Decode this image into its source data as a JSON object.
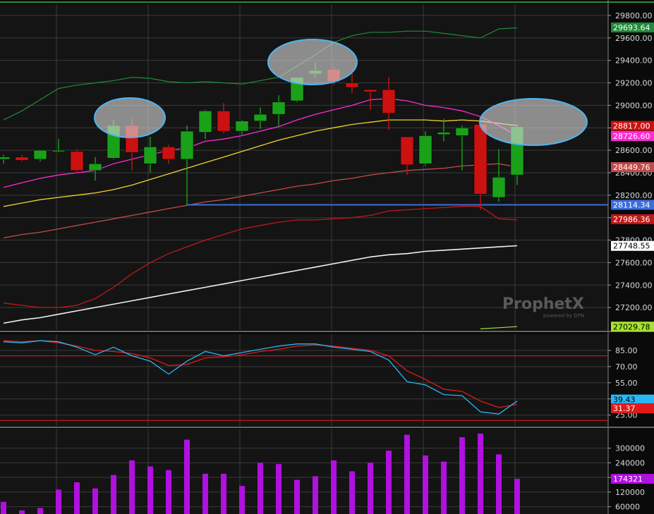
{
  "colors": {
    "background": "#141414",
    "grid": "#3a3a3a",
    "up": "#1aa11a",
    "down": "#cc1111",
    "bb": "#1f8a3a",
    "ema_magenta": "#ff2bd6",
    "ema_yellow": "#f2d22a",
    "sma_red": "#c24a4a",
    "dark_red": "#c01818",
    "white_ma": "#f0f0f0",
    "support": "#3a6ddc",
    "highlight": "#4fb4f0",
    "stoch_k": "#29b6f6",
    "stoch_d": "#e01a1a",
    "volume": "#b010e0",
    "top_border": "#2e8b3a"
  },
  "watermark": {
    "brand": "ProphetX",
    "sub": "powered by DTN"
  },
  "chart_data": [
    {
      "type": "candlestick",
      "panel": "price",
      "ylim": [
        27000,
        29900
      ],
      "yticks": [
        27200,
        27400,
        27600,
        27800,
        28000,
        28200,
        28400,
        28600,
        28800,
        29000,
        29200,
        29400,
        29600,
        29800
      ],
      "ytick_labels": [
        "27200.00",
        "27400.00",
        "27600.00",
        "27800.00",
        "28000.00",
        "28200.00",
        "28400.00",
        "28600.00",
        "28800.00",
        "29000.00",
        "29200.00",
        "29400.00",
        "29600.00",
        "29800.00"
      ],
      "candles": [
        {
          "o": 28520,
          "h": 28560,
          "l": 28480,
          "c": 28540
        },
        {
          "o": 28540,
          "h": 28560,
          "l": 28500,
          "c": 28510
        },
        {
          "o": 28520,
          "h": 28600,
          "l": 28500,
          "c": 28600
        },
        {
          "o": 28600,
          "h": 28700,
          "l": 28580,
          "c": 28600
        },
        {
          "o": 28590,
          "h": 28610,
          "l": 28400,
          "c": 28420
        },
        {
          "o": 28420,
          "h": 28540,
          "l": 28330,
          "c": 28480
        },
        {
          "o": 28530,
          "h": 28870,
          "l": 28520,
          "c": 28820
        },
        {
          "o": 28820,
          "h": 28880,
          "l": 28420,
          "c": 28580
        },
        {
          "o": 28480,
          "h": 28720,
          "l": 28400,
          "c": 28630
        },
        {
          "o": 28630,
          "h": 28650,
          "l": 28480,
          "c": 28520
        },
        {
          "o": 28520,
          "h": 28820,
          "l": 28110,
          "c": 28770
        },
        {
          "o": 28760,
          "h": 28960,
          "l": 28700,
          "c": 28950
        },
        {
          "o": 28950,
          "h": 29020,
          "l": 28750,
          "c": 28770
        },
        {
          "o": 28770,
          "h": 28870,
          "l": 28740,
          "c": 28860
        },
        {
          "o": 28860,
          "h": 28980,
          "l": 28790,
          "c": 28920
        },
        {
          "o": 28920,
          "h": 29090,
          "l": 28810,
          "c": 29030
        },
        {
          "o": 29040,
          "h": 29250,
          "l": 29030,
          "c": 29250
        },
        {
          "o": 29280,
          "h": 29380,
          "l": 29250,
          "c": 29310
        },
        {
          "o": 29320,
          "h": 29350,
          "l": 29180,
          "c": 29210
        },
        {
          "o": 29200,
          "h": 29310,
          "l": 29110,
          "c": 29160
        },
        {
          "o": 29140,
          "h": 29140,
          "l": 28960,
          "c": 29120
        },
        {
          "o": 29140,
          "h": 29250,
          "l": 28780,
          "c": 28930
        },
        {
          "o": 28720,
          "h": 28720,
          "l": 28380,
          "c": 28470
        },
        {
          "o": 28480,
          "h": 28770,
          "l": 28460,
          "c": 28730
        },
        {
          "o": 28740,
          "h": 28880,
          "l": 28680,
          "c": 28760
        },
        {
          "o": 28730,
          "h": 28820,
          "l": 28420,
          "c": 28800
        },
        {
          "o": 28830,
          "h": 28830,
          "l": 28070,
          "c": 28210
        },
        {
          "o": 28180,
          "h": 28610,
          "l": 28140,
          "c": 28360
        },
        {
          "o": 28380,
          "h": 28830,
          "l": 28290,
          "c": 28810
        }
      ],
      "last_price_tags": [
        {
          "label": "29693.64",
          "value": 29693.64,
          "color": "#1f8a3a"
        },
        {
          "label": "28817.00",
          "value": 28817.0,
          "color": "#cc1111"
        },
        {
          "label": "28726.60",
          "value": 28726.6,
          "color": "#ff2bd6"
        },
        {
          "label": "28449.76",
          "value": 28449.76,
          "color": "#c24a4a"
        },
        {
          "label": "28114.34",
          "value": 28114.34,
          "color": "#3a6ddc"
        },
        {
          "label": "27986.36",
          "value": 27986.36,
          "color": "#c01818"
        },
        {
          "label": "27748.55",
          "value": 27748.55,
          "color": "#ffffff"
        },
        {
          "label": "27029.78",
          "value": 27029.78,
          "color": "#a6e22e"
        }
      ],
      "support_level": 28114.34,
      "overlays": {
        "bb_upper": [
          28870,
          28950,
          29050,
          29150,
          29180,
          29200,
          29220,
          29250,
          29240,
          29210,
          29200,
          29210,
          29200,
          29190,
          29220,
          29250,
          29350,
          29450,
          29560,
          29620,
          29650,
          29650,
          29660,
          29660,
          29640,
          29620,
          29600,
          29680,
          29690
        ],
        "ema_magenta": [
          28270,
          28310,
          28350,
          28380,
          28400,
          28420,
          28480,
          28520,
          28560,
          28600,
          28620,
          28680,
          28700,
          28730,
          28770,
          28810,
          28870,
          28920,
          28960,
          29000,
          29050,
          29060,
          29040,
          29000,
          28980,
          28950,
          28900,
          28820,
          28730
        ],
        "ema_yellow": [
          28100,
          28130,
          28160,
          28180,
          28200,
          28220,
          28250,
          28290,
          28340,
          28390,
          28440,
          28490,
          28540,
          28590,
          28640,
          28690,
          28730,
          28770,
          28800,
          28830,
          28850,
          28870,
          28870,
          28870,
          28860,
          28870,
          28860,
          28840,
          28820
        ],
        "sma_red": [
          27820,
          27850,
          27870,
          27900,
          27930,
          27960,
          27990,
          28020,
          28050,
          28080,
          28110,
          28140,
          28160,
          28190,
          28220,
          28250,
          28280,
          28300,
          28330,
          28350,
          28380,
          28400,
          28420,
          28430,
          28440,
          28460,
          28470,
          28480,
          28450
        ],
        "dark_red": [
          27240,
          27220,
          27200,
          27200,
          27220,
          27280,
          27380,
          27500,
          27600,
          27680,
          27740,
          27800,
          27850,
          27900,
          27930,
          27960,
          27980,
          27980,
          27990,
          28000,
          28020,
          28060,
          28070,
          28080,
          28090,
          28100,
          28100,
          27990,
          27980
        ],
        "white_ma": [
          27060,
          27090,
          27110,
          27140,
          27170,
          27200,
          27230,
          27260,
          27290,
          27320,
          27350,
          27380,
          27410,
          27440,
          27470,
          27500,
          27530,
          27560,
          27590,
          27620,
          27650,
          27670,
          27680,
          27700,
          27710,
          27720,
          27730,
          27740,
          27750
        ],
        "green_short": [
          27010,
          27020,
          27030
        ]
      }
    },
    {
      "type": "line",
      "panel": "stochastic",
      "ylim": [
        15,
        100
      ],
      "yticks": [
        25,
        40,
        55,
        70,
        85
      ],
      "ytick_labels": [
        "25.00",
        "",
        "55.00",
        "70.00",
        "85.00"
      ],
      "hlines": [
        80,
        20
      ],
      "series": [
        {
          "values": [
            93,
            92,
            94,
            93,
            88,
            81,
            88,
            80,
            75,
            63,
            75,
            84,
            80,
            83,
            86,
            89,
            91,
            91,
            88,
            86,
            84,
            76,
            56,
            53,
            44,
            43,
            28,
            26,
            38
          ]
        },
        {
          "values": [
            94,
            93,
            94,
            92,
            89,
            85,
            84,
            82,
            78,
            71,
            72,
            78,
            79,
            81,
            84,
            86,
            89,
            90,
            89,
            87,
            85,
            80,
            66,
            58,
            49,
            47,
            38,
            32,
            35
          ]
        }
      ],
      "last_tags": [
        {
          "label": "39.43",
          "value": 39.43,
          "color": "#29b6f6"
        },
        {
          "label": "31.37",
          "value": 31.37,
          "color": "#e01a1a"
        }
      ]
    },
    {
      "type": "bar",
      "panel": "volume",
      "ylim": [
        30000,
        380000
      ],
      "yticks": [
        60000,
        120000,
        180000,
        240000,
        300000
      ],
      "ytick_labels": [
        "60000",
        "120000",
        "",
        "240000",
        "300000"
      ],
      "values": [
        80000,
        45000,
        55000,
        130000,
        160000,
        135000,
        190000,
        250000,
        225000,
        210000,
        335000,
        195000,
        195000,
        145000,
        240000,
        235000,
        170000,
        185000,
        250000,
        205000,
        240000,
        290000,
        355000,
        270000,
        245000,
        345000,
        360000,
        275000,
        174321
      ],
      "last_tags": [
        {
          "label": "174321",
          "value": 174321,
          "color": "#b010e0"
        }
      ]
    }
  ]
}
